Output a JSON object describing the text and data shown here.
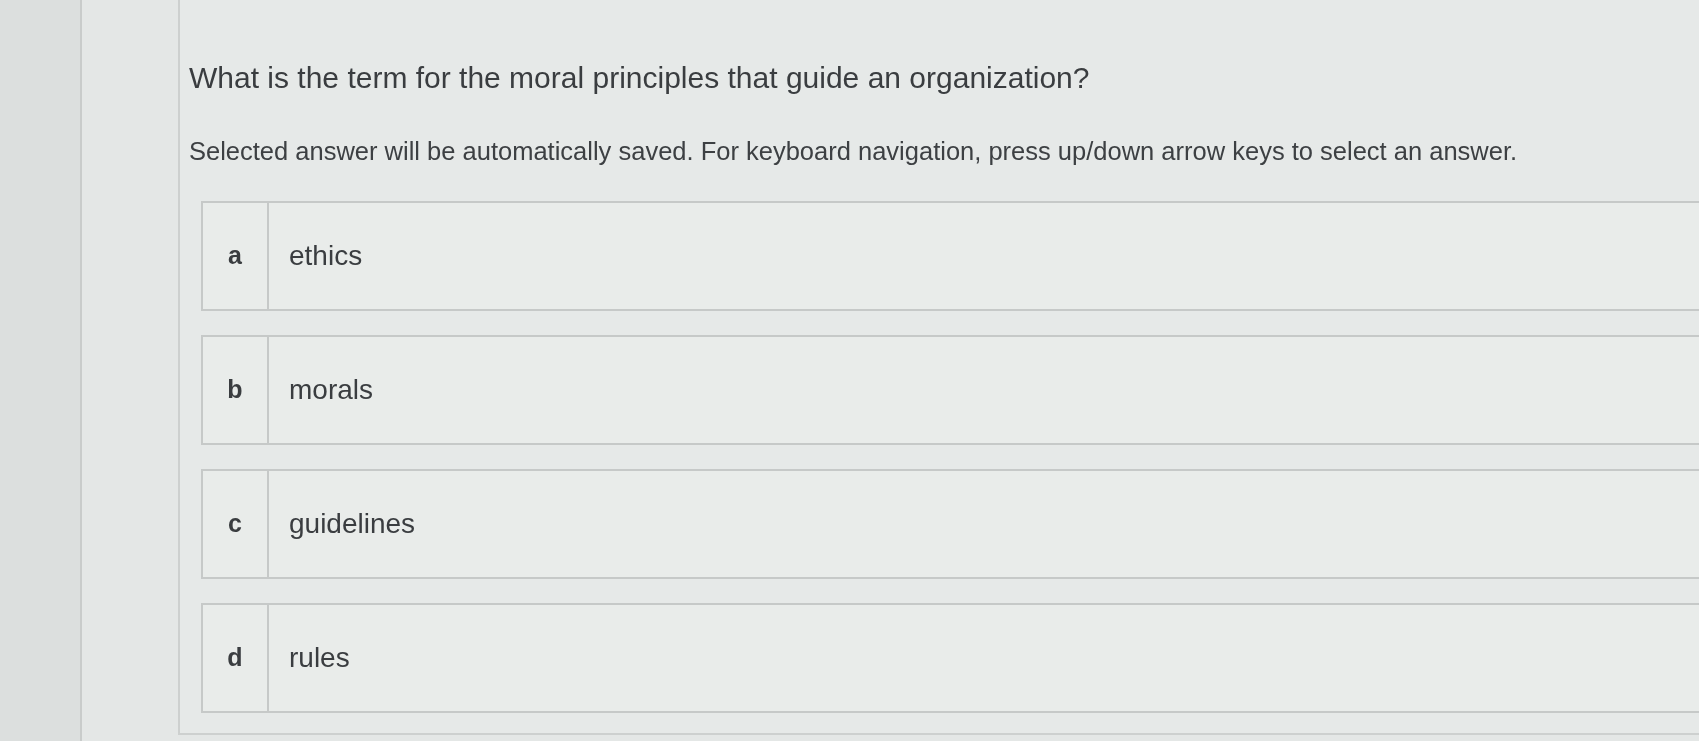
{
  "question": {
    "text": "What is the term for the moral principles that guide an organization?"
  },
  "instruction": "Selected answer will be automatically saved. For keyboard navigation, press up/down arrow keys to select an answer.",
  "options": [
    {
      "letter": "a",
      "text": "ethics",
      "selected": false
    },
    {
      "letter": "b",
      "text": "morals",
      "selected": false
    },
    {
      "letter": "c",
      "text": "guidelines",
      "selected": false
    },
    {
      "letter": "d",
      "text": "rules",
      "selected": false
    }
  ]
}
